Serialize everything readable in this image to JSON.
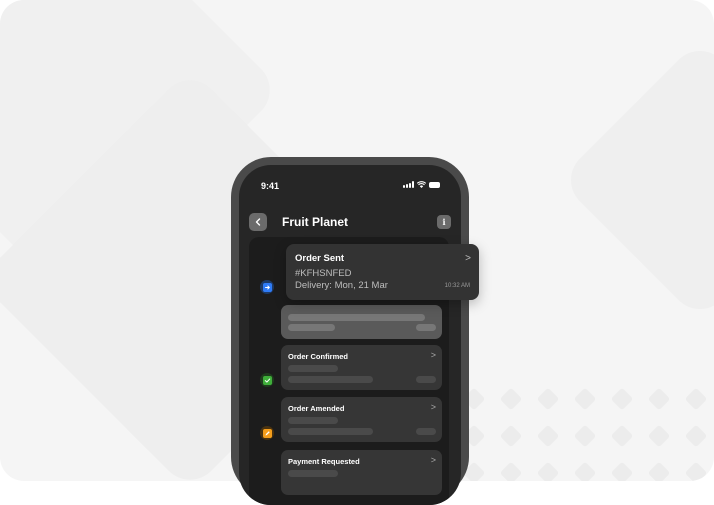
{
  "status": {
    "time": "9:41"
  },
  "header": {
    "title": "Fruit Planet",
    "info_label": "i"
  },
  "popup": {
    "title": "Order Sent",
    "order_id": "#KFHSNFED",
    "delivery": "Delivery: Mon, 21 Mar",
    "time": "10:32 AM",
    "chevron": ">"
  },
  "events": [
    {
      "title": "Order Confirmed",
      "icon": "check-icon",
      "color": "#3fae3a"
    },
    {
      "title": "Order Amended",
      "icon": "edit-icon",
      "color": "#f59e1b"
    },
    {
      "title": "Payment Requested",
      "icon": "payment-icon",
      "color": "#8a8a8a"
    }
  ],
  "colors": {
    "sent": "#2f7bf6",
    "confirmed": "#3fae3a",
    "amended": "#f59e1b"
  },
  "chevron": ">"
}
